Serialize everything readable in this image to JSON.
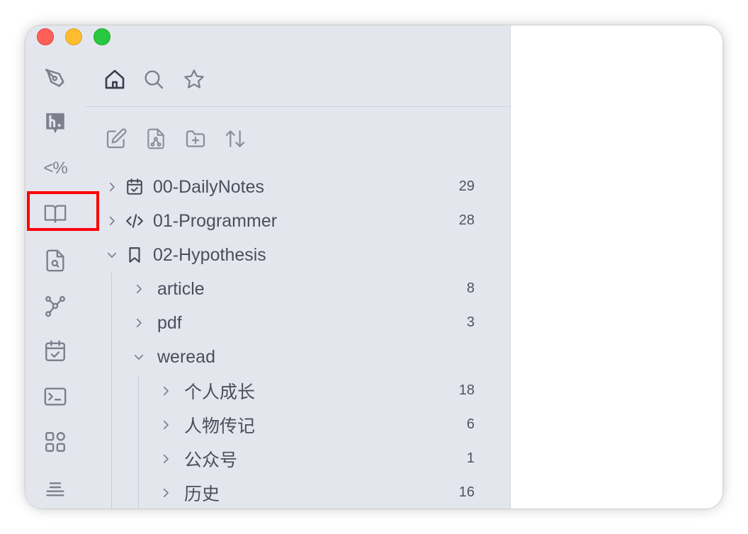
{
  "window": {
    "traffic_lights": [
      "close",
      "minimize",
      "zoom"
    ]
  },
  "ribbon": {
    "items": [
      {
        "icon": "pen-nib-icon"
      },
      {
        "icon": "hypothesis-icon"
      },
      {
        "icon": "templater-icon",
        "text": "<%"
      },
      {
        "icon": "book-open-icon",
        "highlighted": true
      },
      {
        "icon": "file-search-icon"
      },
      {
        "icon": "graph-icon"
      },
      {
        "icon": "calendar-check-icon"
      },
      {
        "icon": "terminal-icon"
      },
      {
        "icon": "grid-icon"
      },
      {
        "icon": "list-icon"
      }
    ],
    "highlight_color": "#ff0000"
  },
  "nav_tabs": [
    {
      "icon": "home-icon",
      "active": true
    },
    {
      "icon": "search-icon",
      "active": false
    },
    {
      "icon": "star-icon",
      "active": false
    }
  ],
  "file_actions": [
    "new-note-icon",
    "new-canvas-icon",
    "new-folder-icon",
    "sort-icon"
  ],
  "tree": [
    {
      "label": "00-DailyNotes",
      "count": "29",
      "expanded": false,
      "icon": "calendar-check-icon"
    },
    {
      "label": "01-Programmer",
      "count": "28",
      "expanded": false,
      "icon": "code-icon"
    },
    {
      "label": "02-Hypothesis",
      "count": "",
      "expanded": true,
      "icon": "bookmark-icon"
    },
    {
      "label": "article",
      "count": "8",
      "expanded": false
    },
    {
      "label": "pdf",
      "count": "3",
      "expanded": false
    },
    {
      "label": "weread",
      "count": "",
      "expanded": true
    },
    {
      "label": "个人成长",
      "count": "18",
      "expanded": false
    },
    {
      "label": "人物传记",
      "count": "6",
      "expanded": false
    },
    {
      "label": "公众号",
      "count": "1",
      "expanded": false
    },
    {
      "label": "历史",
      "count": "16",
      "expanded": false
    }
  ],
  "colors": {
    "sidebar_bg": "#e4e6ee",
    "content_bg": "#ffffff",
    "text": "#4a4e5c",
    "icon": "#7d808c"
  }
}
